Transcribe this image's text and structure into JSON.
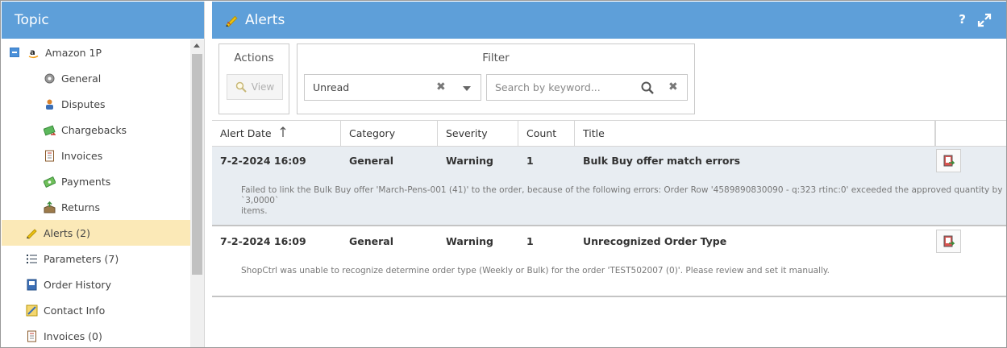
{
  "left_panel": {
    "title": "Topic",
    "tree": [
      {
        "label": "Amazon 1P",
        "icon": "amazon-logo-icon",
        "level": 0,
        "selected": false
      },
      {
        "label": "General",
        "icon": "gear-icon",
        "level": 1,
        "selected": false
      },
      {
        "label": "Disputes",
        "icon": "person-dispute-icon",
        "level": 1,
        "selected": false
      },
      {
        "label": "Chargebacks",
        "icon": "money-back-icon",
        "level": 1,
        "selected": false
      },
      {
        "label": "Invoices",
        "icon": "invoice-icon",
        "level": 1,
        "selected": false
      },
      {
        "label": "Payments",
        "icon": "payment-icon",
        "level": 1,
        "selected": false
      },
      {
        "label": "Returns",
        "icon": "return-box-icon",
        "level": 1,
        "selected": false
      },
      {
        "label": "Alerts (2)",
        "icon": "alert-pen-icon",
        "level": 0,
        "selected": true
      },
      {
        "label": "Parameters (7)",
        "icon": "list-icon",
        "level": 0,
        "selected": false
      },
      {
        "label": "Order History",
        "icon": "history-book-icon",
        "level": 0,
        "selected": false
      },
      {
        "label": "Contact Info",
        "icon": "contact-card-icon",
        "level": 0,
        "selected": false
      },
      {
        "label": "Invoices (0)",
        "icon": "invoice-icon",
        "level": 0,
        "selected": false
      }
    ]
  },
  "main": {
    "title": "Alerts",
    "title_icon": "alert-pen-icon",
    "help_label": "?",
    "actions": {
      "title": "Actions",
      "view_label": "View"
    },
    "filter": {
      "title": "Filter",
      "status_value": "Unread",
      "search_placeholder": "Search by keyword..."
    },
    "columns": [
      "Alert Date",
      "Category",
      "Severity",
      "Count",
      "Title"
    ],
    "rows": [
      {
        "date": "7-2-2024 16:09",
        "category": "General",
        "severity": "Warning",
        "count": "1",
        "title": "Bulk Buy offer match errors",
        "message_line1": "Failed to link the Bulk Buy offer 'March-Pens-001 (41)' to the order, because of the following errors: Order Row '4589890830090 - q:323 rtinc:0' exceeded the approved quantity by `3,0000`",
        "message_line2": "items."
      },
      {
        "date": "7-2-2024 16:09",
        "category": "General",
        "severity": "Warning",
        "count": "1",
        "title": "Unrecognized Order Type",
        "message_line1": "ShopCtrl was unable to recognize determine order type (Weekly or Bulk) for the order 'TEST502007 (0)'. Please review and set it manually.",
        "message_line2": ""
      }
    ]
  },
  "colors": {
    "header_blue": "#5e9fd9",
    "selected_row": "#fbe9b7",
    "alt_row": "#e8edf2"
  }
}
